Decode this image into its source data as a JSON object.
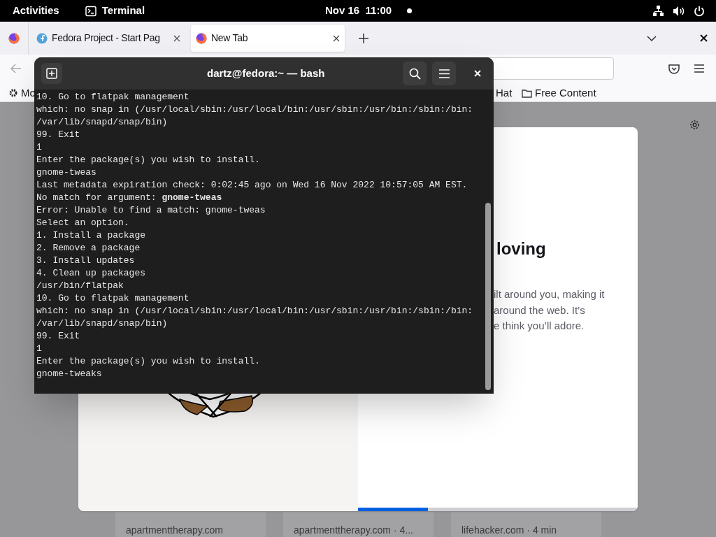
{
  "top_bar": {
    "activities": "Activities",
    "app": "Terminal",
    "clock": "Nov 16  11:00"
  },
  "browser": {
    "tabs": [
      {
        "label": "Fedora Project - Start Pag",
        "selected": false
      },
      {
        "label": "New Tab",
        "selected": true
      }
    ],
    "bookmarks": [
      {
        "label": "Mo",
        "kind": "settings"
      },
      {
        "label": "Hat",
        "kind": "plain"
      },
      {
        "label": "Free Content",
        "kind": "folder"
      }
    ]
  },
  "welcome_card": {
    "heading": "loving",
    "paragraph": [
      "ilt around you, making it",
      "around the web. It’s",
      "e think you’ll adore."
    ],
    "progress": {
      "level": 0.25
    }
  },
  "stories": [
    {
      "source": "apartmenttherapy.com"
    },
    {
      "source": "apartmenttherapy.com · 4..."
    },
    {
      "source": "lifehacker.com · 4 min"
    }
  ],
  "terminal": {
    "title": "dartz@fedora:~ — bash",
    "lines": [
      "10. Go to flatpak management",
      "which: no snap in (/usr/local/sbin:/usr/local/bin:/usr/sbin:/usr/bin:/sbin:/bin:",
      "/var/lib/snapd/snap/bin)",
      "99. Exit",
      "1",
      "Enter the package(s) you wish to install.",
      "gnome-tweas",
      "Last metadata expiration check: 0:02:45 ago on Wed 16 Nov 2022 10:57:05 AM EST.",
      "No match for argument: **gnome-tweas**",
      "Error: Unable to find a match: gnome-tweas",
      "Select an option.",
      "1. Install a package",
      "2. Remove a package",
      "3. Install updates",
      "4. Clean up packages",
      "/usr/bin/flatpak",
      "10. Go to flatpak management",
      "which: no snap in (/usr/local/sbin:/usr/local/bin:/usr/sbin:/usr/bin:/sbin:/bin:",
      "/var/lib/snapd/snap/bin)",
      "99. Exit",
      "1",
      "Enter the package(s) you wish to install.",
      "gnome-tweaks"
    ]
  }
}
